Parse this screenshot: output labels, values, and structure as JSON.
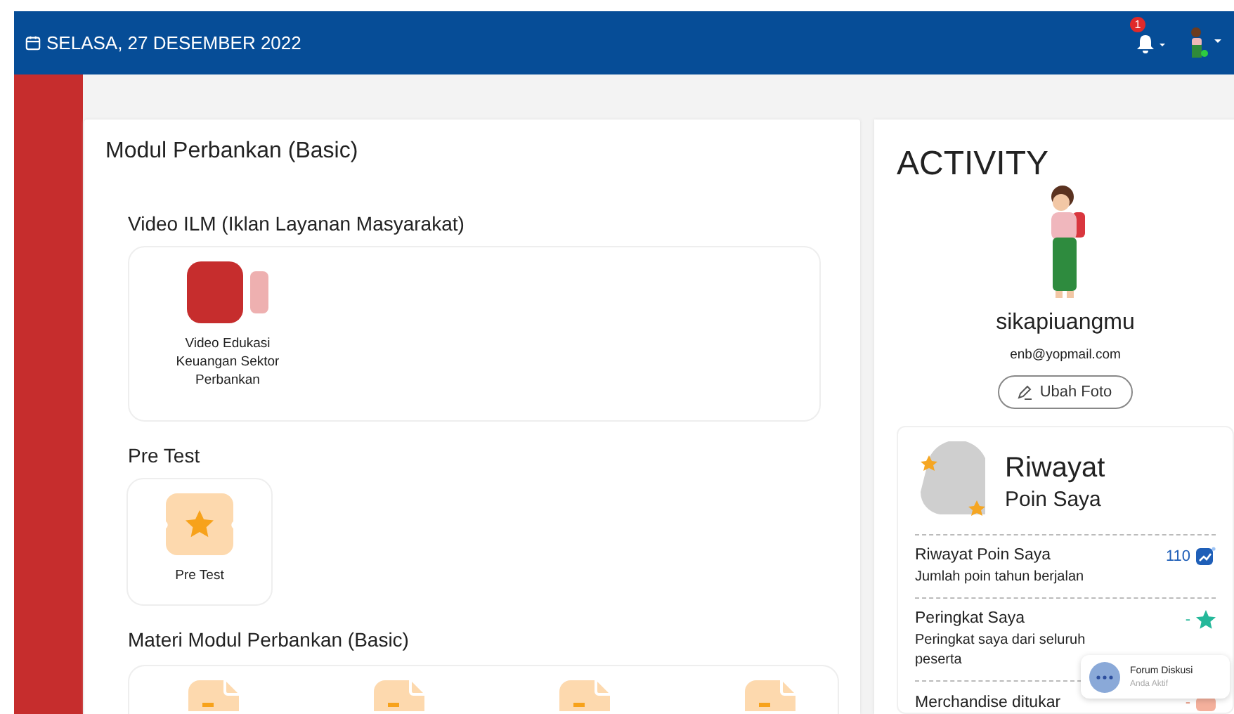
{
  "header": {
    "date": "SELASA, 27 DESEMBER 2022",
    "notification_count": "1"
  },
  "module": {
    "title": "Modul Perbankan (Basic)",
    "sections": [
      {
        "kind": "video",
        "title": "Video ILM (Iklan Layanan Masyarakat)",
        "items": [
          {
            "kind": "video",
            "label": "Video Edukasi Keuangan Sektor Perbankan"
          }
        ]
      },
      {
        "kind": "test",
        "title": "Pre Test",
        "items": [
          {
            "kind": "ticket",
            "label": "Pre Test"
          }
        ]
      },
      {
        "kind": "materi",
        "title": "Materi Modul Perbankan (Basic)",
        "items": [
          {
            "kind": "document"
          },
          {
            "kind": "document"
          },
          {
            "kind": "document"
          },
          {
            "kind": "document"
          }
        ]
      }
    ]
  },
  "activity": {
    "title": "ACTIVITY",
    "username": "sikapiuangmu",
    "email": "enb@yopmail.com",
    "button": "Ubah Foto"
  },
  "points": {
    "title": "Riwayat",
    "subtitle": "Poin Saya",
    "rows": [
      {
        "kind": "trend",
        "title": "Riwayat Poin Saya",
        "description": "Jumlah poin tahun berjalan",
        "value": "110"
      },
      {
        "kind": "rank",
        "title": "Peringkat Saya",
        "description": "Peringkat saya dari seluruh peserta",
        "value": "-"
      },
      {
        "kind": "merch",
        "title": "Merchandise ditukar",
        "value": "-"
      }
    ]
  },
  "chat": {
    "title": "Forum Diskusi",
    "status": "Anda Aktif"
  }
}
